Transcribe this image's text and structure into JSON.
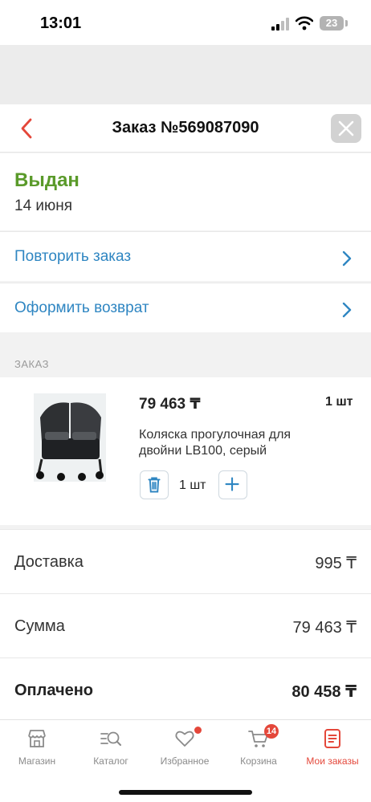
{
  "status_bar": {
    "time": "13:01",
    "battery": "23"
  },
  "header": {
    "title": "Заказ №569087090"
  },
  "order_status": {
    "title": "Выдан",
    "date": "14 июня"
  },
  "actions": [
    {
      "label": "Повторить заказ"
    },
    {
      "label": "Оформить возврат"
    }
  ],
  "section_label": "ЗАКАЗ",
  "product": {
    "price": "79 463 ₸",
    "quantity_label": "1 шт",
    "name": "Коляска прогулочная для двойни LB100, серый",
    "stepper_value": "1 шт"
  },
  "summary": [
    {
      "label": "Доставка",
      "value": "995 ₸"
    },
    {
      "label": "Сумма",
      "value": "79 463 ₸"
    },
    {
      "label": "Оплачено",
      "value": "80 458 ₸"
    }
  ],
  "tabs": [
    {
      "label": "Магазин",
      "icon": "store-icon"
    },
    {
      "label": "Каталог",
      "icon": "catalog-search-icon"
    },
    {
      "label": "Избранное",
      "icon": "heart-icon"
    },
    {
      "label": "Корзина",
      "icon": "cart-icon",
      "badge": "14"
    },
    {
      "label": "Мои заказы",
      "icon": "orders-icon"
    }
  ],
  "colors": {
    "accent": "#e4473a",
    "link": "#2f86c2",
    "status_green": "#5a9a2a"
  }
}
